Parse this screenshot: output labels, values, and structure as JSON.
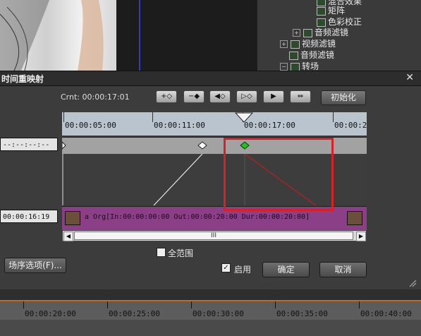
{
  "tree": {
    "items": [
      "混合效果",
      "矩阵",
      "色彩校正",
      "音频滤镜",
      "视频滤镜",
      "音频滤镜",
      "转场"
    ]
  },
  "dialog": {
    "title": "时间重映射",
    "close_label": "✕",
    "crnt_label": "Crnt: 00:00:17:01",
    "tool_buttons": [
      "+◇",
      "−◆",
      "◀◇",
      "▷◇",
      "▶",
      "⇔"
    ],
    "init_label": "初始化",
    "ruler_labels": [
      "00:00:05:00",
      "00:00:11:00",
      "00:00:17:00",
      "00:00:2"
    ],
    "side_time_top": "--:--:--:--",
    "side_time_bottom": "00:00:16:19",
    "clip_label": "a  Org[In:00:00:00:00 Out:00:00:20:00 Dur:00:00:20:00]",
    "scroll_thumb_label": "III",
    "full_range_label": "全范围",
    "full_range_checked": false,
    "enable_label": "启用",
    "enable_checked": true,
    "ok_label": "确定",
    "cancel_label": "取消",
    "scene_options_label": "场序选项(F)..."
  },
  "bottom_timeline": {
    "labels": [
      "00:00:20:00",
      "00:00:25:00",
      "00:00:30:00",
      "00:00:35:00",
      "00:00:40:00"
    ]
  },
  "colors": {
    "highlight": "#d8202a",
    "clip": "#8a3f86",
    "keyframe_active": "#22c122"
  }
}
